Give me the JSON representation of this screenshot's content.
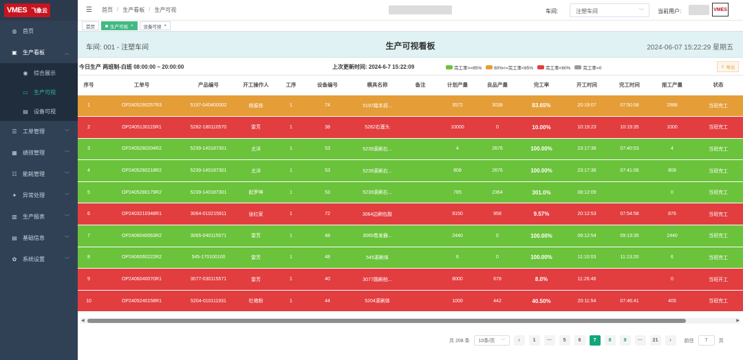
{
  "brand": {
    "logo_text": "VMES",
    "logo_cn": "飞象云"
  },
  "sidebar": {
    "items": [
      {
        "label": "首页",
        "icon": "dashboard-icon",
        "glyph": "◍"
      },
      {
        "label": "生产看板",
        "icon": "board-icon",
        "glyph": "▣",
        "open": true,
        "children": [
          {
            "label": "综合展示",
            "icon": "eye-icon",
            "glyph": "◉"
          },
          {
            "label": "生产可视",
            "icon": "monitor-icon",
            "glyph": "▭",
            "active": true
          },
          {
            "label": "设备可视",
            "icon": "device-icon",
            "glyph": "▤"
          }
        ]
      },
      {
        "label": "工单管理",
        "icon": "order-icon",
        "glyph": "☰"
      },
      {
        "label": "绩效管理",
        "icon": "performance-icon",
        "glyph": "▦"
      },
      {
        "label": "能耗管理",
        "icon": "energy-icon",
        "glyph": "☷"
      },
      {
        "label": "异常处理",
        "icon": "alert-icon",
        "glyph": "✦"
      },
      {
        "label": "生产报表",
        "icon": "report-icon",
        "glyph": "▥"
      },
      {
        "label": "基础信息",
        "icon": "info-icon",
        "glyph": "▤"
      },
      {
        "label": "系统设置",
        "icon": "settings-icon",
        "glyph": "✿"
      }
    ]
  },
  "topbar": {
    "breadcrumb": [
      "首页",
      "生产看板",
      "生产可视"
    ],
    "workshop_label": "车间:",
    "workshop_value": "注塑车间",
    "user_label": "当前用户:",
    "avatar_text": "VMES"
  },
  "tags": [
    {
      "label": "首页",
      "active": false
    },
    {
      "label": "生产可视",
      "active": true
    },
    {
      "label": "设备可视",
      "active": false
    }
  ],
  "board": {
    "workshop": "车间: 001 - 注塑车间",
    "title": "生产可视看板",
    "datetime": "2024-06-07 15:22:29 星期五",
    "today": "今日生产   两班制-白班 08:00:00 ~ 20:00:00",
    "last_update": "上次更新时间: 2024-6-7 15:22:09",
    "export_label": "导出",
    "legend": [
      {
        "label": "完工率>=85%",
        "color": "#6bc23b"
      },
      {
        "label": "60%<=完工率<85%",
        "color": "#e59d37"
      },
      {
        "label": "完工率<60%",
        "color": "#e23d3f"
      },
      {
        "label": "完工率=0",
        "color": "#999999"
      }
    ]
  },
  "table": {
    "columns": [
      "序号",
      "工单号",
      "产品编号",
      "开工操作人",
      "工序",
      "设备编号",
      "模具名称",
      "备注",
      "计划产量",
      "良品产量",
      "完工率",
      "开工时间",
      "完工时间",
      "报工产量",
      "状态"
    ],
    "rows": [
      {
        "color": "orange",
        "cells": [
          "1",
          "OP2405290257R3",
          "5197-040400002",
          "杨振铁",
          "1",
          "74",
          "5197踏本捏...",
          "",
          "3572",
          "3038",
          "83.65%",
          "20:19:07",
          "07:50:58",
          "2988",
          "当班完工"
        ]
      },
      {
        "color": "red",
        "cells": [
          "2",
          "OP2405130115R1",
          "5282-180110570",
          "雷芳",
          "1",
          "38",
          "5282右塞头",
          "",
          "10000",
          "0",
          "10.00%",
          "10:19:23",
          "10:19:35",
          "1000",
          "当班完工"
        ]
      },
      {
        "color": "green",
        "cells": [
          "3",
          "OP2405280204R2",
          "5239-140187301",
          "尤洋",
          "1",
          "53",
          "5239滚刷右...",
          "",
          "4",
          "2676",
          "100.00%",
          "23:17:36",
          "07:40:53",
          "4",
          "当班完工"
        ]
      },
      {
        "color": "green",
        "cells": [
          "4",
          "OP2405280218R2",
          "5239-140187301",
          "尤洋",
          "1",
          "53",
          "5239滚刷右...",
          "",
          "808",
          "2676",
          "100.00%",
          "23:17:36",
          "07:41:06",
          "808",
          "当班完工"
        ]
      },
      {
        "color": "green",
        "cells": [
          "5",
          "OP2405280179R2",
          "5239-140187301",
          "起罗坤",
          "1",
          "53",
          "5239滚刷右...",
          "",
          "785",
          "2364",
          "301.0%",
          "08:12:09",
          "",
          "0",
          "当班完工"
        ]
      },
      {
        "color": "red",
        "cells": [
          "6",
          "OP2403210348R1",
          "3064-010215911",
          "张红家",
          "1",
          "72",
          "3064边刷包胶",
          "",
          "9150",
          "958",
          "9.57%",
          "20:12:53",
          "07:54:58",
          "876",
          "当班完工"
        ]
      },
      {
        "color": "green",
        "cells": [
          "7",
          "OP2406040063R2",
          "3065-040115571",
          "雷芳",
          "1",
          "48",
          "3065卷发器...",
          "",
          "2440",
          "0",
          "100.00%",
          "09:12:54",
          "09:13:35",
          "2440",
          "当班完工"
        ]
      },
      {
        "color": "green",
        "cells": [
          "8",
          "OP2406060222R2",
          "545-170100100",
          "雷芳",
          "1",
          "48",
          "545滚刷体",
          "",
          "6",
          "0",
          "100.00%",
          "11:10:03",
          "11:13:20",
          "6",
          "当班完工"
        ]
      },
      {
        "color": "red",
        "cells": [
          "9",
          "OP2406040070R1",
          "3077-030115571",
          "雷芳",
          "1",
          "40",
          "3077圆刷柏...",
          "",
          "8000",
          "678",
          "8.0%",
          "11:26:46",
          "",
          "0",
          "当班开工"
        ]
      },
      {
        "color": "red",
        "cells": [
          "10",
          "OP2405240158R1",
          "5204-010111931",
          "杜艳粉",
          "1",
          "44",
          "5204滚刷体",
          "",
          "1000",
          "442",
          "40.50%",
          "20:11:54",
          "07:46:41",
          "405",
          "当班完工"
        ]
      }
    ]
  },
  "pagination": {
    "total": "共 208 条",
    "page_size": "10条/页",
    "prev": "‹",
    "next": "›",
    "pages": [
      "1",
      "···",
      "5",
      "6",
      "7",
      "8",
      "9",
      "···",
      "21"
    ],
    "current": "7",
    "goto_label": "前往",
    "goto_value": "7",
    "goto_suffix": "页"
  }
}
